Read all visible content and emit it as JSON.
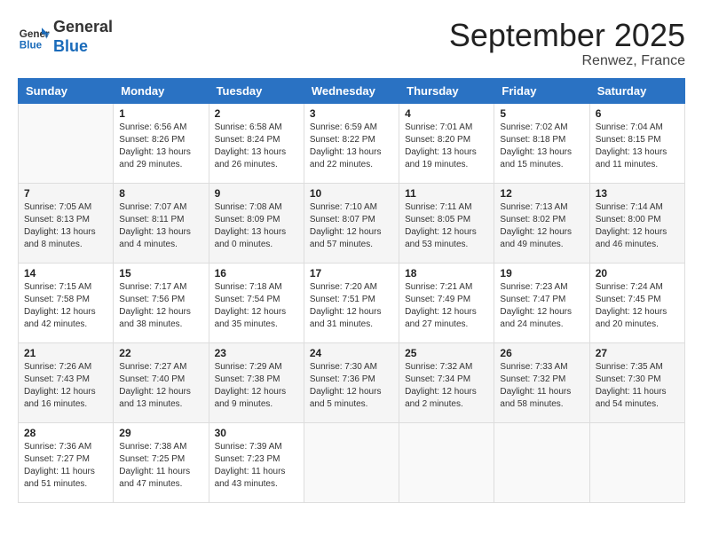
{
  "header": {
    "logo_line1": "General",
    "logo_line2": "Blue",
    "month": "September 2025",
    "location": "Renwez, France"
  },
  "days_of_week": [
    "Sunday",
    "Monday",
    "Tuesday",
    "Wednesday",
    "Thursday",
    "Friday",
    "Saturday"
  ],
  "weeks": [
    [
      {
        "day": "",
        "info": ""
      },
      {
        "day": "1",
        "info": "Sunrise: 6:56 AM\nSunset: 8:26 PM\nDaylight: 13 hours\nand 29 minutes."
      },
      {
        "day": "2",
        "info": "Sunrise: 6:58 AM\nSunset: 8:24 PM\nDaylight: 13 hours\nand 26 minutes."
      },
      {
        "day": "3",
        "info": "Sunrise: 6:59 AM\nSunset: 8:22 PM\nDaylight: 13 hours\nand 22 minutes."
      },
      {
        "day": "4",
        "info": "Sunrise: 7:01 AM\nSunset: 8:20 PM\nDaylight: 13 hours\nand 19 minutes."
      },
      {
        "day": "5",
        "info": "Sunrise: 7:02 AM\nSunset: 8:18 PM\nDaylight: 13 hours\nand 15 minutes."
      },
      {
        "day": "6",
        "info": "Sunrise: 7:04 AM\nSunset: 8:15 PM\nDaylight: 13 hours\nand 11 minutes."
      }
    ],
    [
      {
        "day": "7",
        "info": "Sunrise: 7:05 AM\nSunset: 8:13 PM\nDaylight: 13 hours\nand 8 minutes."
      },
      {
        "day": "8",
        "info": "Sunrise: 7:07 AM\nSunset: 8:11 PM\nDaylight: 13 hours\nand 4 minutes."
      },
      {
        "day": "9",
        "info": "Sunrise: 7:08 AM\nSunset: 8:09 PM\nDaylight: 13 hours\nand 0 minutes."
      },
      {
        "day": "10",
        "info": "Sunrise: 7:10 AM\nSunset: 8:07 PM\nDaylight: 12 hours\nand 57 minutes."
      },
      {
        "day": "11",
        "info": "Sunrise: 7:11 AM\nSunset: 8:05 PM\nDaylight: 12 hours\nand 53 minutes."
      },
      {
        "day": "12",
        "info": "Sunrise: 7:13 AM\nSunset: 8:02 PM\nDaylight: 12 hours\nand 49 minutes."
      },
      {
        "day": "13",
        "info": "Sunrise: 7:14 AM\nSunset: 8:00 PM\nDaylight: 12 hours\nand 46 minutes."
      }
    ],
    [
      {
        "day": "14",
        "info": "Sunrise: 7:15 AM\nSunset: 7:58 PM\nDaylight: 12 hours\nand 42 minutes."
      },
      {
        "day": "15",
        "info": "Sunrise: 7:17 AM\nSunset: 7:56 PM\nDaylight: 12 hours\nand 38 minutes."
      },
      {
        "day": "16",
        "info": "Sunrise: 7:18 AM\nSunset: 7:54 PM\nDaylight: 12 hours\nand 35 minutes."
      },
      {
        "day": "17",
        "info": "Sunrise: 7:20 AM\nSunset: 7:51 PM\nDaylight: 12 hours\nand 31 minutes."
      },
      {
        "day": "18",
        "info": "Sunrise: 7:21 AM\nSunset: 7:49 PM\nDaylight: 12 hours\nand 27 minutes."
      },
      {
        "day": "19",
        "info": "Sunrise: 7:23 AM\nSunset: 7:47 PM\nDaylight: 12 hours\nand 24 minutes."
      },
      {
        "day": "20",
        "info": "Sunrise: 7:24 AM\nSunset: 7:45 PM\nDaylight: 12 hours\nand 20 minutes."
      }
    ],
    [
      {
        "day": "21",
        "info": "Sunrise: 7:26 AM\nSunset: 7:43 PM\nDaylight: 12 hours\nand 16 minutes."
      },
      {
        "day": "22",
        "info": "Sunrise: 7:27 AM\nSunset: 7:40 PM\nDaylight: 12 hours\nand 13 minutes."
      },
      {
        "day": "23",
        "info": "Sunrise: 7:29 AM\nSunset: 7:38 PM\nDaylight: 12 hours\nand 9 minutes."
      },
      {
        "day": "24",
        "info": "Sunrise: 7:30 AM\nSunset: 7:36 PM\nDaylight: 12 hours\nand 5 minutes."
      },
      {
        "day": "25",
        "info": "Sunrise: 7:32 AM\nSunset: 7:34 PM\nDaylight: 12 hours\nand 2 minutes."
      },
      {
        "day": "26",
        "info": "Sunrise: 7:33 AM\nSunset: 7:32 PM\nDaylight: 11 hours\nand 58 minutes."
      },
      {
        "day": "27",
        "info": "Sunrise: 7:35 AM\nSunset: 7:30 PM\nDaylight: 11 hours\nand 54 minutes."
      }
    ],
    [
      {
        "day": "28",
        "info": "Sunrise: 7:36 AM\nSunset: 7:27 PM\nDaylight: 11 hours\nand 51 minutes."
      },
      {
        "day": "29",
        "info": "Sunrise: 7:38 AM\nSunset: 7:25 PM\nDaylight: 11 hours\nand 47 minutes."
      },
      {
        "day": "30",
        "info": "Sunrise: 7:39 AM\nSunset: 7:23 PM\nDaylight: 11 hours\nand 43 minutes."
      },
      {
        "day": "",
        "info": ""
      },
      {
        "day": "",
        "info": ""
      },
      {
        "day": "",
        "info": ""
      },
      {
        "day": "",
        "info": ""
      }
    ]
  ]
}
